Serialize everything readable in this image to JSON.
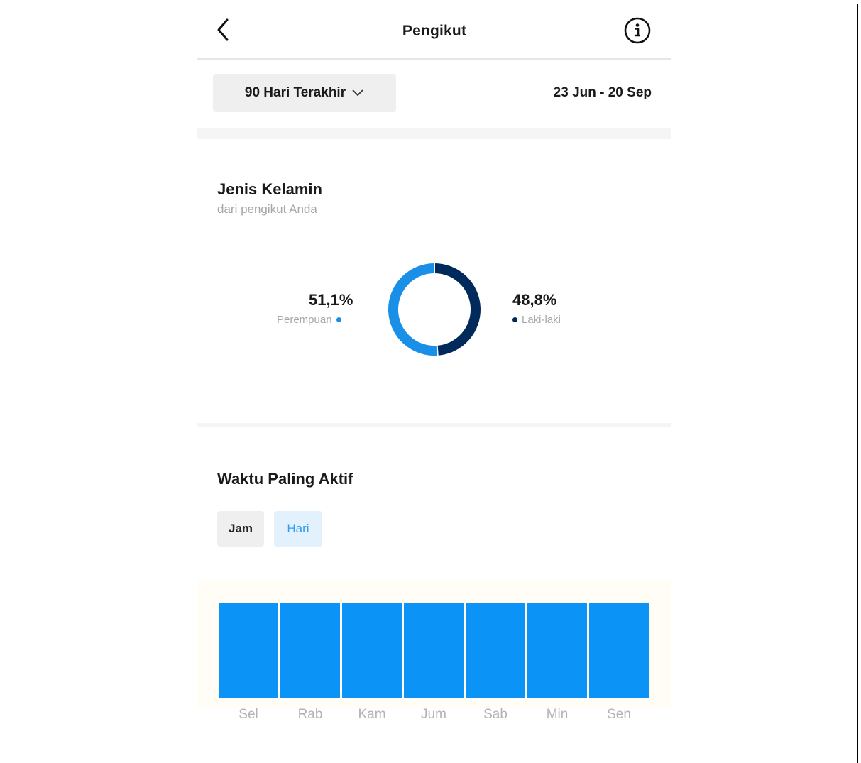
{
  "header": {
    "title": "Pengikut",
    "back_icon": "chevron-left-icon",
    "info_icon": "info-circle-icon"
  },
  "filter": {
    "range_label": "90 Hari Terakhir",
    "range_icon": "chevron-down-icon",
    "date_range": "23 Jun - 20 Sep"
  },
  "gender": {
    "title": "Jenis Kelamin",
    "subtitle": "dari pengikut Anda",
    "female_pct": "51,1%",
    "female_label": "Perempuan",
    "male_pct": "48,8%",
    "male_label": "Laki-laki",
    "female_color": "#1a8fe8",
    "male_color": "#002a5c"
  },
  "active": {
    "title": "Waktu Paling Aktif",
    "tab_hours": "Jam",
    "tab_days": "Hari",
    "active_tab": "Hari",
    "bar_color": "#0b93f6"
  },
  "chart_data": [
    {
      "type": "pie",
      "categories": [
        "Perempuan",
        "Laki-laki"
      ],
      "values": [
        51.1,
        48.8
      ],
      "colors": [
        "#1a8fe8",
        "#002a5c"
      ]
    },
    {
      "type": "bar",
      "categories": [
        "Sel",
        "Rab",
        "Kam",
        "Jum",
        "Sab",
        "Min",
        "Sen"
      ],
      "values": [
        1,
        1,
        1,
        1,
        1,
        1,
        1
      ]
    }
  ]
}
